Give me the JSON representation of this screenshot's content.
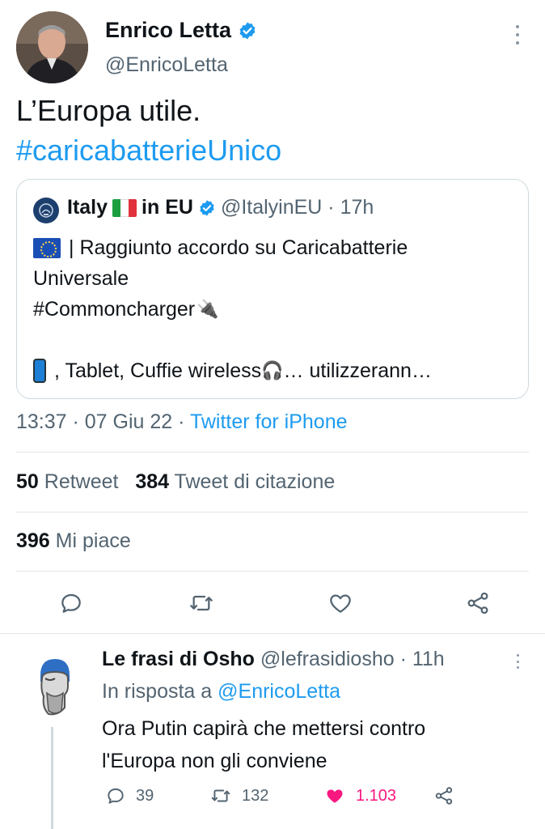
{
  "tweet": {
    "author_name": "Enrico Letta",
    "author_handle": "@EnricoLetta",
    "text": "L’Europa utile.",
    "hashtag": "#caricabatterieUnico",
    "timestamp": "13:37 · 07 Giu 22 · ",
    "source": "Twitter for iPhone",
    "verified": true
  },
  "quote": {
    "name_part1": "Italy",
    "name_part2": "in EU",
    "handle_time": "@ItalyinEU · 17h",
    "line1_text": "| Raggiunto accordo su Caricabatterie",
    "line2_text": "Universale",
    "line3_text": "#Commoncharger",
    "line5_text_a": ", Tablet, Cuffie wireless",
    "line5_text_b": "… utilizzerann…"
  },
  "stats": {
    "retweets_count": "50",
    "retweets_label": "Retweet",
    "quotes_count": "384",
    "quotes_label": "Tweet di citazione",
    "likes_count": "396",
    "likes_label": "Mi piace"
  },
  "reply": {
    "name": "Le frasi di Osho",
    "handle_time": "@lefrasidiosho · 11h",
    "in_reply_prefix": "In risposta a ",
    "in_reply_mention": "@EnricoLetta",
    "text_line1": "Ora Putin capirà che mettersi contro",
    "text_line2": "l'Europa non gli conviene",
    "replies_count": "39",
    "retweets_count": "132",
    "likes_count": "1.103"
  },
  "colors": {
    "accent": "#1d9bf0",
    "like_pink": "#f91880",
    "muted": "#536471"
  },
  "icons": [
    "verified-badge-icon",
    "more-options-icon",
    "reply-icon",
    "retweet-icon",
    "like-icon",
    "share-icon"
  ]
}
